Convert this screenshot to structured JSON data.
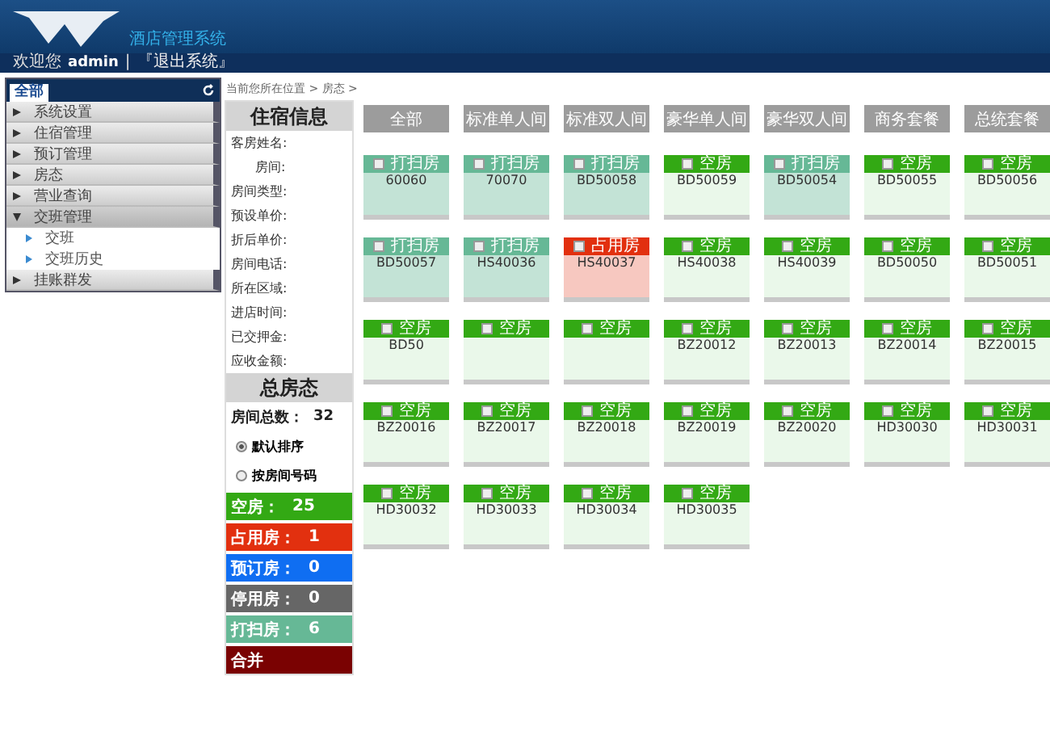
{
  "header": {
    "subtitle": "酒店管理系统",
    "welcome": "欢迎您",
    "user": "admin",
    "separator": "|",
    "logout": "『退出系统』"
  },
  "sidebar": {
    "tab": "全部",
    "items": [
      {
        "label": "系统设置",
        "expanded": false
      },
      {
        "label": "住宿管理",
        "expanded": false
      },
      {
        "label": "预订管理",
        "expanded": false
      },
      {
        "label": "房态",
        "expanded": false
      },
      {
        "label": "营业查询",
        "expanded": false
      },
      {
        "label": "交班管理",
        "expanded": true,
        "children": [
          {
            "label": "交班"
          },
          {
            "label": "交班历史"
          }
        ]
      },
      {
        "label": "挂账群发",
        "expanded": false
      }
    ]
  },
  "breadcrumb": "当前您所在位置 > 房态 >",
  "info": {
    "title": "住宿信息",
    "fields": [
      {
        "label": "客房姓名:"
      },
      {
        "label": "房间:"
      },
      {
        "label": "房间类型:"
      },
      {
        "label": "预设单价:"
      },
      {
        "label": "折后单价:"
      },
      {
        "label": "房间电话:"
      },
      {
        "label": "所在区域:"
      },
      {
        "label": "进店时间:"
      },
      {
        "label": "已交押金:"
      },
      {
        "label": "应收金额:"
      }
    ]
  },
  "summary": {
    "title": "总房态",
    "total_label": "房间总数：",
    "total": "32",
    "sort_options": [
      {
        "label": "默认排序",
        "selected": true
      },
      {
        "label": "按房间号码",
        "selected": false
      }
    ],
    "statuses": [
      {
        "label": "空房：",
        "count": "25",
        "color": "#33a914"
      },
      {
        "label": "占用房：",
        "count": "1",
        "color": "#e2300f"
      },
      {
        "label": "预订房：",
        "count": "0",
        "color": "#0f6ef2"
      },
      {
        "label": "停用房：",
        "count": "0",
        "color": "#666666"
      },
      {
        "label": "打扫房：",
        "count": "6",
        "color": "#66b896"
      },
      {
        "label": "合并",
        "color": "#7a0202"
      }
    ]
  },
  "filters": [
    {
      "label": "全部",
      "selected": false
    },
    {
      "label": "标准单人间",
      "selected": false
    },
    {
      "label": "标准双人间",
      "selected": false
    },
    {
      "label": "豪华单人间",
      "selected": false
    },
    {
      "label": "豪华双人间",
      "selected": false
    },
    {
      "label": "商务套餐",
      "selected": false
    },
    {
      "label": "总统套餐",
      "selected": false
    }
  ],
  "rooms": [
    {
      "kind": "cleaning",
      "status": "打扫房",
      "number": "60060",
      "checked": false
    },
    {
      "kind": "cleaning",
      "status": "打扫房",
      "number": "70070",
      "checked": false
    },
    {
      "kind": "cleaning",
      "status": "打扫房",
      "number": "BD50058",
      "checked": false
    },
    {
      "kind": "vacant",
      "status": "空房",
      "number": "BD50059",
      "checked": false
    },
    {
      "kind": "cleaning",
      "status": "打扫房",
      "number": "BD50054",
      "checked": false
    },
    {
      "kind": "vacant",
      "status": "空房",
      "number": "BD50055",
      "checked": false
    },
    {
      "kind": "vacant",
      "status": "空房",
      "number": "BD50056",
      "checked": false
    },
    {
      "kind": "cleaning",
      "status": "打扫房",
      "number": "BD50057",
      "checked": false
    },
    {
      "kind": "cleaning",
      "status": "打扫房",
      "number": "HS40036",
      "checked": false
    },
    {
      "kind": "occupied",
      "status": "占用房",
      "number": "HS40037",
      "checked": false
    },
    {
      "kind": "vacant",
      "status": "空房",
      "number": "HS40038",
      "checked": false
    },
    {
      "kind": "vacant",
      "status": "空房",
      "number": "HS40039",
      "checked": false
    },
    {
      "kind": "vacant",
      "status": "空房",
      "number": "BD50050",
      "checked": false
    },
    {
      "kind": "vacant",
      "status": "空房",
      "number": "BD50051",
      "checked": false
    },
    {
      "kind": "vacant",
      "status": "空房",
      "number": "BD50",
      "checked": false
    },
    {
      "kind": "vacant",
      "status": "空房",
      "checked": false
    },
    {
      "kind": "vacant",
      "status": "空房",
      "checked": false
    },
    {
      "kind": "vacant",
      "status": "空房",
      "number": "BZ20012",
      "checked": false
    },
    {
      "kind": "vacant",
      "status": "空房",
      "number": "BZ20013",
      "checked": false
    },
    {
      "kind": "vacant",
      "status": "空房",
      "number": "BZ20014",
      "checked": false
    },
    {
      "kind": "vacant",
      "status": "空房",
      "number": "BZ20015",
      "checked": false
    },
    {
      "kind": "vacant",
      "status": "空房",
      "number": "BZ20016",
      "checked": false
    },
    {
      "kind": "vacant",
      "status": "空房",
      "number": "BZ20017",
      "checked": false
    },
    {
      "kind": "vacant",
      "status": "空房",
      "number": "BZ20018",
      "checked": false
    },
    {
      "kind": "vacant",
      "status": "空房",
      "number": "BZ20019",
      "checked": false
    },
    {
      "kind": "vacant",
      "status": "空房",
      "number": "BZ20020",
      "checked": false
    },
    {
      "kind": "vacant",
      "status": "空房",
      "number": "HD30030",
      "checked": false
    },
    {
      "kind": "vacant",
      "status": "空房",
      "number": "HD30031",
      "checked": false
    },
    {
      "kind": "vacant",
      "status": "空房",
      "number": "HD30032",
      "checked": false
    },
    {
      "kind": "vacant",
      "status": "空房",
      "number": "HD30033",
      "checked": false
    },
    {
      "kind": "vacant",
      "status": "空房",
      "number": "HD30034",
      "checked": false
    },
    {
      "kind": "vacant",
      "status": "空房",
      "number": "HD30035",
      "checked": false
    }
  ]
}
